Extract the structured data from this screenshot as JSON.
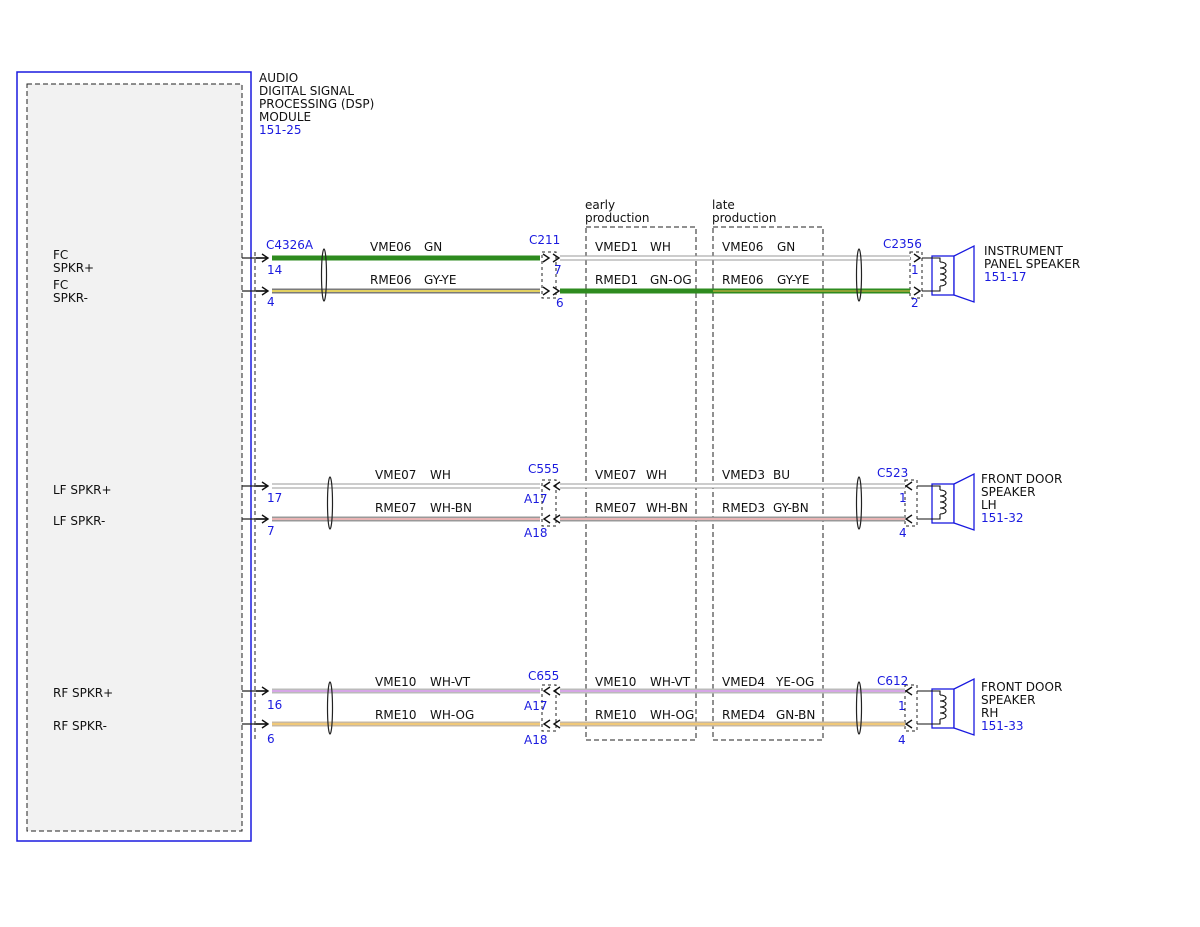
{
  "module": {
    "title_lines": [
      "AUDIO",
      "DIGITAL SIGNAL",
      "PROCESSING (DSP)",
      "MODULE"
    ],
    "ref": "151-25",
    "pins": {
      "fc_pos": [
        "FC",
        "SPKR+"
      ],
      "fc_neg": [
        "FC",
        "SPKR-"
      ],
      "lf_pos": "LF SPKR+",
      "lf_neg": "LF SPKR-",
      "rf_pos": "RF SPKR+",
      "rf_neg": "RF SPKR-"
    }
  },
  "production": {
    "early": [
      "early",
      "production"
    ],
    "late": [
      "late",
      "production"
    ]
  },
  "connectors": {
    "c4326a": "C4326A",
    "c211": "C211",
    "c555": "C555",
    "c655": "C655",
    "c2356": "C2356",
    "c523": "C523",
    "c612": "C612"
  },
  "pin_numbers": {
    "fc_pos_module": "14",
    "fc_neg_module": "4",
    "fc_pos_inline": "7",
    "fc_neg_inline": "6",
    "fc_pos_speaker": "1",
    "fc_neg_speaker": "2",
    "lf_pos_module": "17",
    "lf_neg_module": "7",
    "lf_pos_inline": "A17",
    "lf_neg_inline": "A18",
    "lf_pos_speaker": "1",
    "lf_neg_speaker": "4",
    "rf_pos_module": "16",
    "rf_neg_module": "6",
    "rf_pos_inline": "A17",
    "rf_neg_inline": "A18",
    "rf_pos_speaker": "1",
    "rf_neg_speaker": "4"
  },
  "circuits": {
    "fc_pos": {
      "seg1": [
        "VME06",
        "GN"
      ],
      "early": [
        "VMED1",
        "WH"
      ],
      "late": [
        "VME06",
        "GN"
      ]
    },
    "fc_neg": {
      "seg1": [
        "RME06",
        "GY-YE"
      ],
      "early": [
        "RMED1",
        "GN-OG"
      ],
      "late": [
        "RME06",
        "GY-YE"
      ]
    },
    "lf_pos": {
      "seg1": [
        "VME07",
        "WH"
      ],
      "early": [
        "VME07",
        "WH"
      ],
      "late": [
        "VMED3",
        "BU"
      ]
    },
    "lf_neg": {
      "seg1": [
        "RME07",
        "WH-BN"
      ],
      "early": [
        "RME07",
        "WH-BN"
      ],
      "late": [
        "RMED3",
        "GY-BN"
      ]
    },
    "rf_pos": {
      "seg1": [
        "VME10",
        "WH-VT"
      ],
      "early": [
        "VME10",
        "WH-VT"
      ],
      "late": [
        "VMED4",
        "YE-OG"
      ]
    },
    "rf_neg": {
      "seg1": [
        "RME10",
        "WH-OG"
      ],
      "early": [
        "RME10",
        "WH-OG"
      ],
      "late": [
        "RMED4",
        "GN-BN"
      ]
    }
  },
  "speakers": {
    "ip": {
      "lines": [
        "INSTRUMENT",
        "PANEL SPEAKER"
      ],
      "ref": "151-17"
    },
    "lh": {
      "lines": [
        "FRONT DOOR",
        "SPEAKER",
        "LH"
      ],
      "ref": "151-32"
    },
    "rh": {
      "lines": [
        "FRONT DOOR",
        "SPEAKER",
        "RH"
      ],
      "ref": "151-33"
    }
  },
  "colors": {
    "outline_blue": "#1a1adf",
    "label_blue": "#1a1adf",
    "wire_green": "#2e8b1f",
    "wire_grey": "#8c8c8c",
    "wire_yellow": "#e2d060",
    "wire_pink": "#e8b4b4",
    "wire_violet": "#d6a6e6",
    "wire_orange": "#f0b070",
    "module_fill": "#f2f2f2"
  }
}
